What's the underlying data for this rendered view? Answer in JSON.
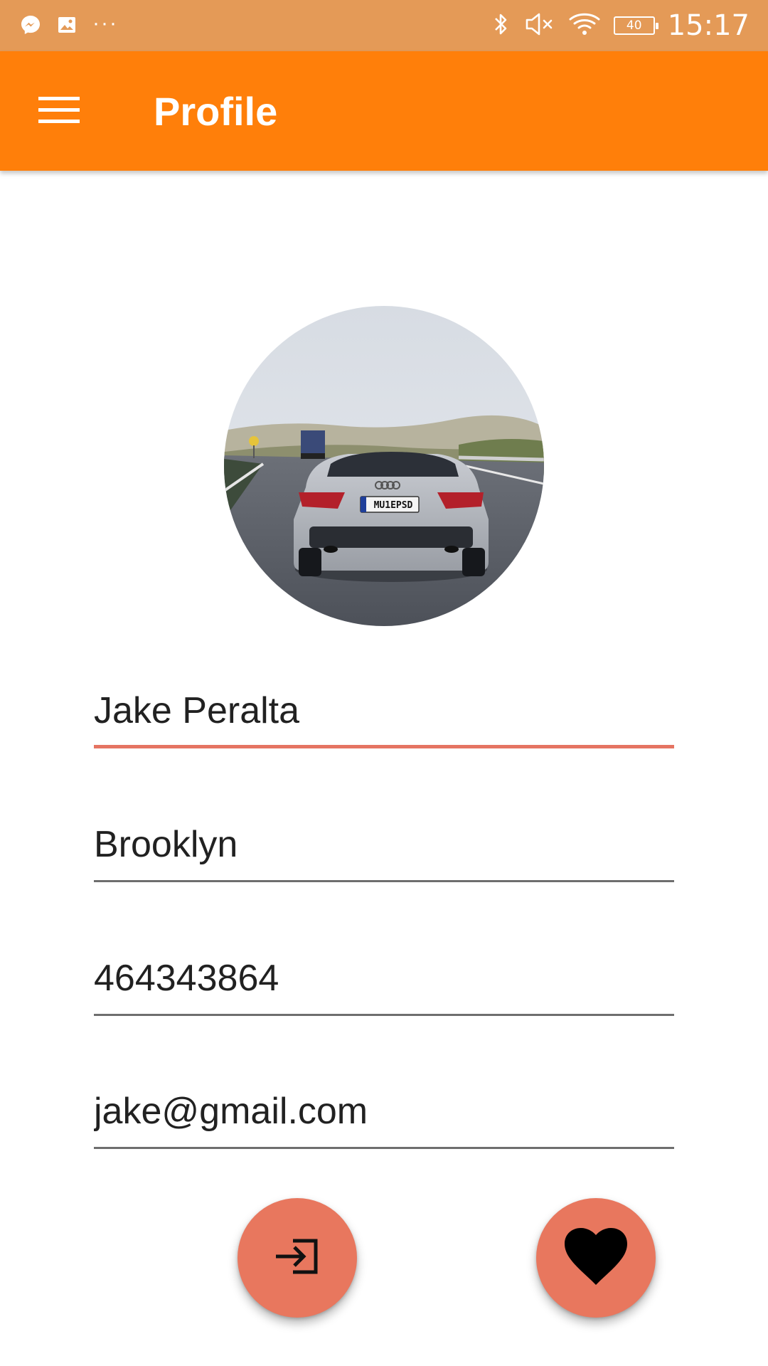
{
  "status_bar": {
    "time": "15:17",
    "battery_level": "40",
    "notification_icons": [
      "messenger-icon",
      "image-icon"
    ],
    "overflow_dots": "···",
    "system_icons": [
      "bluetooth-icon",
      "volume-mute-icon",
      "wifi-icon",
      "battery-icon"
    ]
  },
  "app_bar": {
    "title": "Profile",
    "menu_icon": "hamburger-menu-icon"
  },
  "avatar": {
    "plate_text": "MU1EPSD"
  },
  "form": {
    "name": "Jake Peralta",
    "city": "Brooklyn",
    "phone": "464343864",
    "email": "jake@gmail.com"
  },
  "actions": {
    "login_icon": "login-icon",
    "favorite_icon": "heart-icon"
  },
  "colors": {
    "status_bar": "#e49a57",
    "app_bar": "#ff7f0a",
    "accent": "#e8775e",
    "focused_underline": "#e57462",
    "text": "#212121"
  }
}
